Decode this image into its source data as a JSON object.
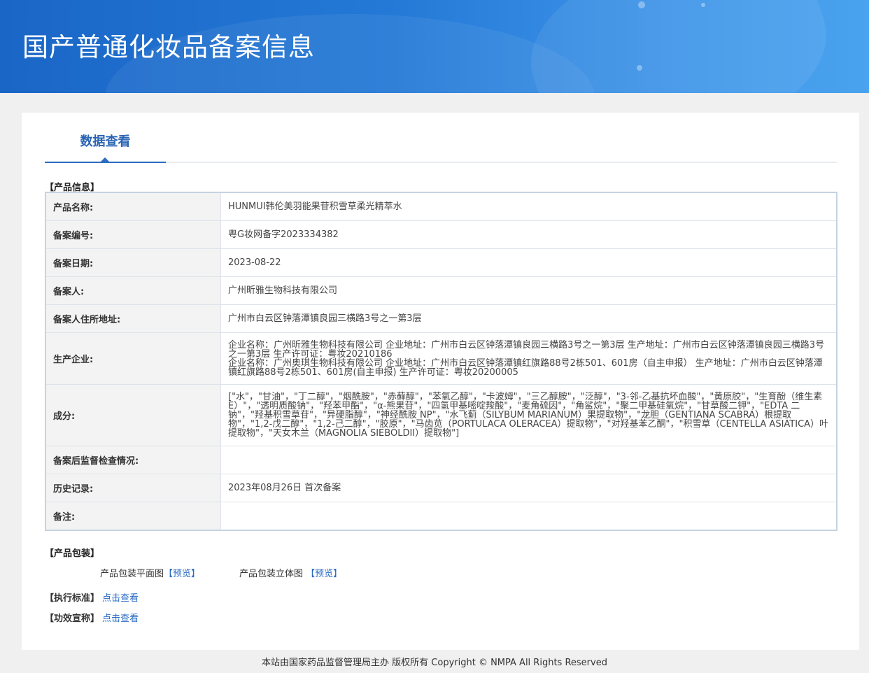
{
  "banner": {
    "title": "国产普通化妆品备案信息"
  },
  "tabs": {
    "active_label": "数据查看"
  },
  "product_info": {
    "section_label": "【产品信息】",
    "rows": [
      {
        "label": "产品名称:",
        "value": "HUNMUI韩伦美羽能果苷积雪草柔光精萃水"
      },
      {
        "label": "备案编号:",
        "value": "粤G妆网备字2023334382"
      },
      {
        "label": "备案日期:",
        "value": "2023-08-22"
      },
      {
        "label": "备案人:",
        "value": "广州昕雅生物科技有限公司"
      },
      {
        "label": "备案人住所地址:",
        "value": "广州市白云区钟落潭镇良园三横路3号之一第3层"
      },
      {
        "label": "生产企业:",
        "value": "企业名称：广州昕雅生物科技有限公司 企业地址：广州市白云区钟落潭镇良园三横路3号之一第3层 生产地址：广州市白云区钟落潭镇良园三横路3号之一第3层 生产许可证：粤妆20210186\n企业名称：广州奥琪生物科技有限公司 企业地址：广州市白云区钟落潭镇红旗路88号2栋501、601房（自主申报） 生产地址：广州市白云区钟落潭镇红旗路88号2栋501、601房(自主申报) 生产许可证：粤妆20200005"
      },
      {
        "label": "成分:",
        "value": "[\"水\"，\"甘油\"，\"丁二醇\"，\"烟酰胺\"，\"赤藓醇\"，\"苯氧乙醇\"，\"卡波姆\"，\"三乙醇胺\"，\"泛醇\"，\"3-邻-乙基抗坏血酸\"，\"黄原胶\"，\"生育酚（维生素E）\"，\"透明质酸钠\"，\"羟苯甲酯\"，\"α-熊果苷\"，\"四氢甲基嘧啶羧酸\"，\"麦角硫因\"，\"角鲨烷\"，\"聚二甲基硅氧烷\"，\"甘草酸二钾\"，\"EDTA 二钠\"，\"羟基积雪草苷\"，\"异硬脂醇\"，\"神经酰胺 NP\"，\"水飞蓟（SILYBUM MARIANUM）果提取物\"，\"龙胆（GENTIANA SCABRA）根提取物\"，\"1,2-戊二醇\"，\"1,2-己二醇\"，\"胶原\"，\"马齿苋（PORTULACA OLERACEA）提取物\"，\"对羟基苯乙酮\"，\"积雪草（CENTELLA ASIATICA）叶提取物\"，\"天女木兰（MAGNOLIA SIEBOLDII）提取物\"]"
      },
      {
        "label": "备案后监督检查情况:",
        "value": ""
      },
      {
        "label": "历史记录:",
        "value": "2023年08月26日 首次备案"
      },
      {
        "label": "备注:",
        "value": ""
      }
    ]
  },
  "packaging": {
    "section_label": "【产品包装】",
    "flat_label": "产品包装平面图",
    "flat_link": "【预览】",
    "stereo_label": "产品包装立体图",
    "stereo_link": "【预览】"
  },
  "standard": {
    "label": "【执行标准】",
    "link": "点击查看"
  },
  "efficacy": {
    "label": "【功效宣称】",
    "link": "点击查看"
  },
  "footer": {
    "text": "本站由国家药品监督管理局主办 版权所有 Copyright © NMPA All Rights Reserved"
  }
}
